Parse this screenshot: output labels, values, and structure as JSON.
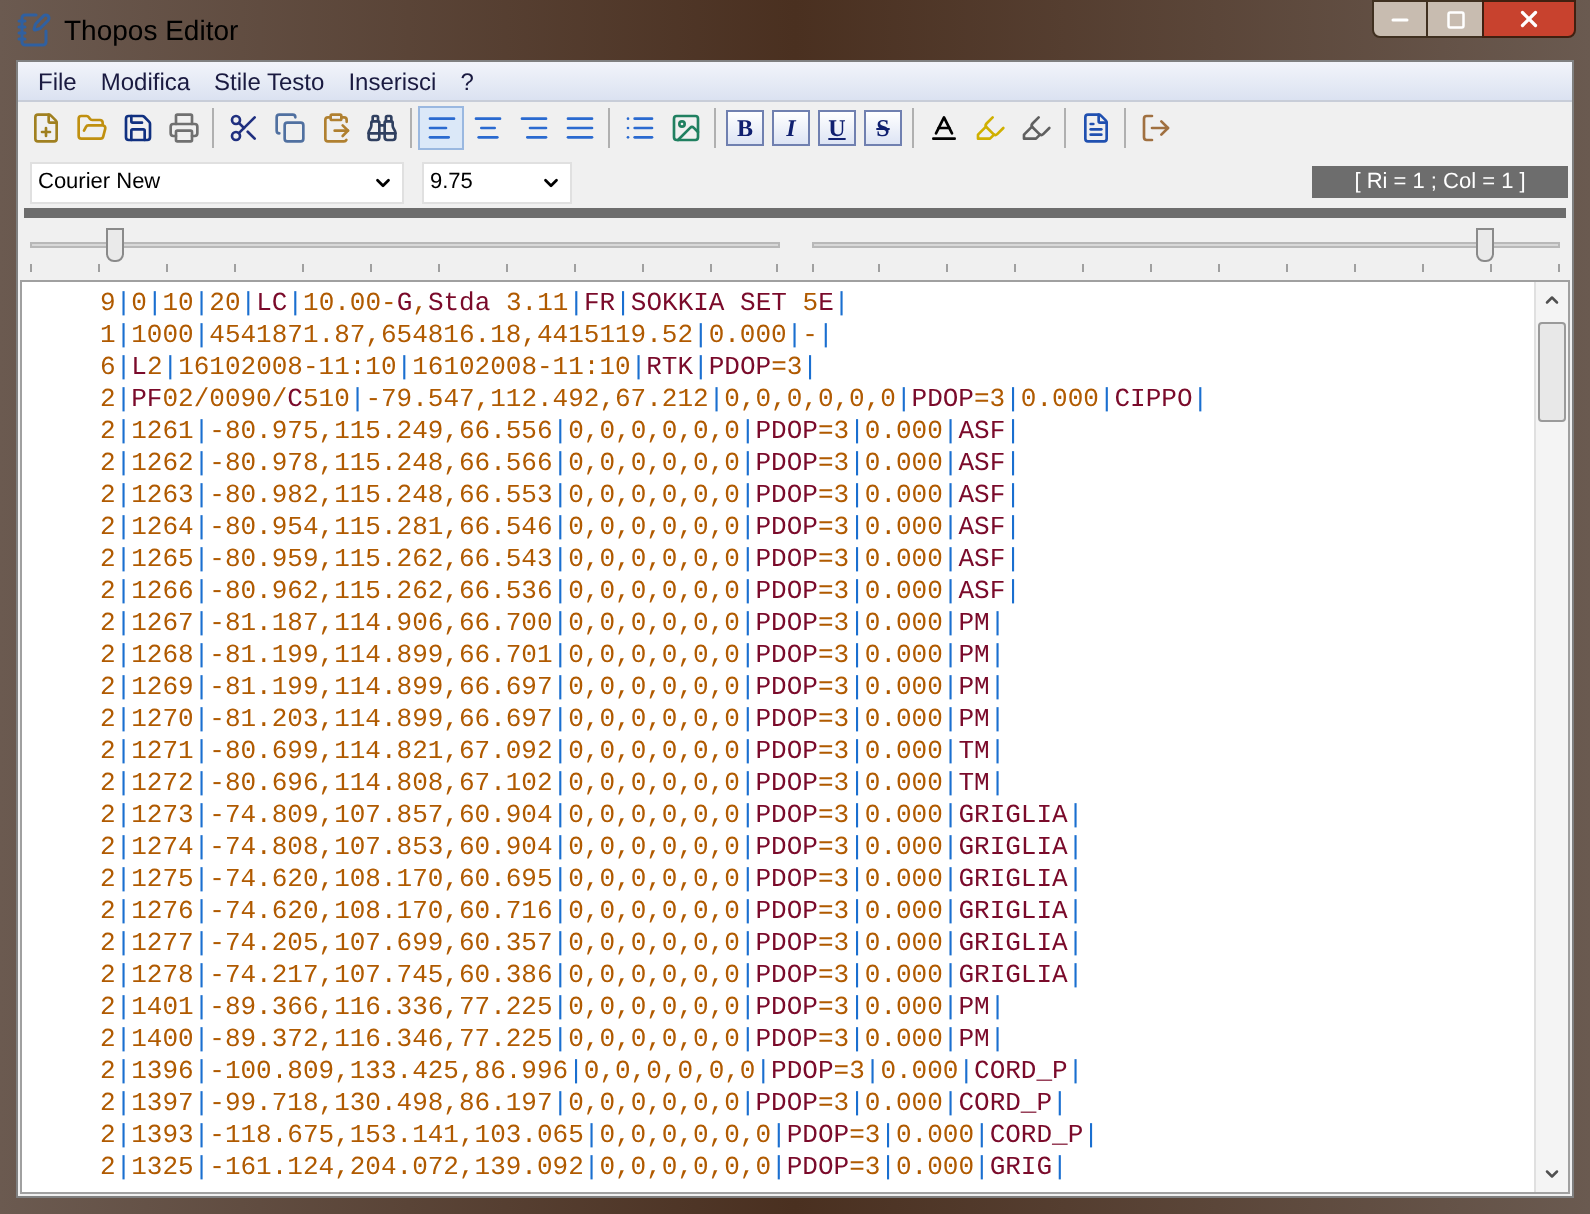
{
  "window": {
    "title": "Thopos Editor"
  },
  "menu": [
    "File",
    "Modifica",
    "Stile Testo",
    "Inserisci",
    "?"
  ],
  "alignment_buttons": [
    {
      "selected": true
    },
    {
      "selected": false
    },
    {
      "selected": false
    },
    {
      "selected": false
    }
  ],
  "format_buttons": [
    {
      "kind": "bold",
      "label": "B"
    },
    {
      "kind": "italic",
      "label": "I"
    },
    {
      "kind": "underline",
      "label": "U"
    },
    {
      "kind": "strike",
      "label": "S"
    }
  ],
  "font_combo": {
    "value": "Courier New"
  },
  "size_combo": {
    "value": "9.75"
  },
  "status": "[ Ri = 1 ; Col = 1 ]",
  "sliders": [
    {
      "level": 0.11
    },
    {
      "level": 0.9
    }
  ],
  "lines": [
    "9|0|10|20|LC|10.00-G,Stda 3.11|FR|SOKKIA SET 5E|",
    "1|1000|4541871.87,654816.18,4415119.52|0.000|-|",
    "6|L2|16102008-11:10|16102008-11:10|RTK|PDOP=3|",
    "2|PF02/0090/C510|-79.547,112.492,67.212|0,0,0,0,0,0|PDOP=3|0.000|CIPPO|",
    "2|1261|-80.975,115.249,66.556|0,0,0,0,0,0|PDOP=3|0.000|ASF|",
    "2|1262|-80.978,115.248,66.566|0,0,0,0,0,0|PDOP=3|0.000|ASF|",
    "2|1263|-80.982,115.248,66.553|0,0,0,0,0,0|PDOP=3|0.000|ASF|",
    "2|1264|-80.954,115.281,66.546|0,0,0,0,0,0|PDOP=3|0.000|ASF|",
    "2|1265|-80.959,115.262,66.543|0,0,0,0,0,0|PDOP=3|0.000|ASF|",
    "2|1266|-80.962,115.262,66.536|0,0,0,0,0,0|PDOP=3|0.000|ASF|",
    "2|1267|-81.187,114.906,66.700|0,0,0,0,0,0|PDOP=3|0.000|PM|",
    "2|1268|-81.199,114.899,66.701|0,0,0,0,0,0|PDOP=3|0.000|PM|",
    "2|1269|-81.199,114.899,66.697|0,0,0,0,0,0|PDOP=3|0.000|PM|",
    "2|1270|-81.203,114.899,66.697|0,0,0,0,0,0|PDOP=3|0.000|PM|",
    "2|1271|-80.699,114.821,67.092|0,0,0,0,0,0|PDOP=3|0.000|TM|",
    "2|1272|-80.696,114.808,67.102|0,0,0,0,0,0|PDOP=3|0.000|TM|",
    "2|1273|-74.809,107.857,60.904|0,0,0,0,0,0|PDOP=3|0.000|GRIGLIA|",
    "2|1274|-74.808,107.853,60.904|0,0,0,0,0,0|PDOP=3|0.000|GRIGLIA|",
    "2|1275|-74.620,108.170,60.695|0,0,0,0,0,0|PDOP=3|0.000|GRIGLIA|",
    "2|1276|-74.620,108.170,60.716|0,0,0,0,0,0|PDOP=3|0.000|GRIGLIA|",
    "2|1277|-74.205,107.699,60.357|0,0,0,0,0,0|PDOP=3|0.000|GRIGLIA|",
    "2|1278|-74.217,107.745,60.386|0,0,0,0,0,0|PDOP=3|0.000|GRIGLIA|",
    "2|1401|-89.366,116.336,77.225|0,0,0,0,0,0|PDOP=3|0.000|PM|",
    "2|1400|-89.372,116.346,77.225|0,0,0,0,0,0|PDOP=3|0.000|PM|",
    "2|1396|-100.809,133.425,86.996|0,0,0,0,0,0|PDOP=3|0.000|CORD_P|",
    "2|1397|-99.718,130.498,86.197|0,0,0,0,0,0|PDOP=3|0.000|CORD_P|",
    "2|1393|-118.675,153.141,103.065|0,0,0,0,0,0|PDOP=3|0.000|CORD_P|",
    "2|1325|-161.124,204.072,139.092|0,0,0,0,0,0|PDOP=3|0.000|GRIG|"
  ]
}
